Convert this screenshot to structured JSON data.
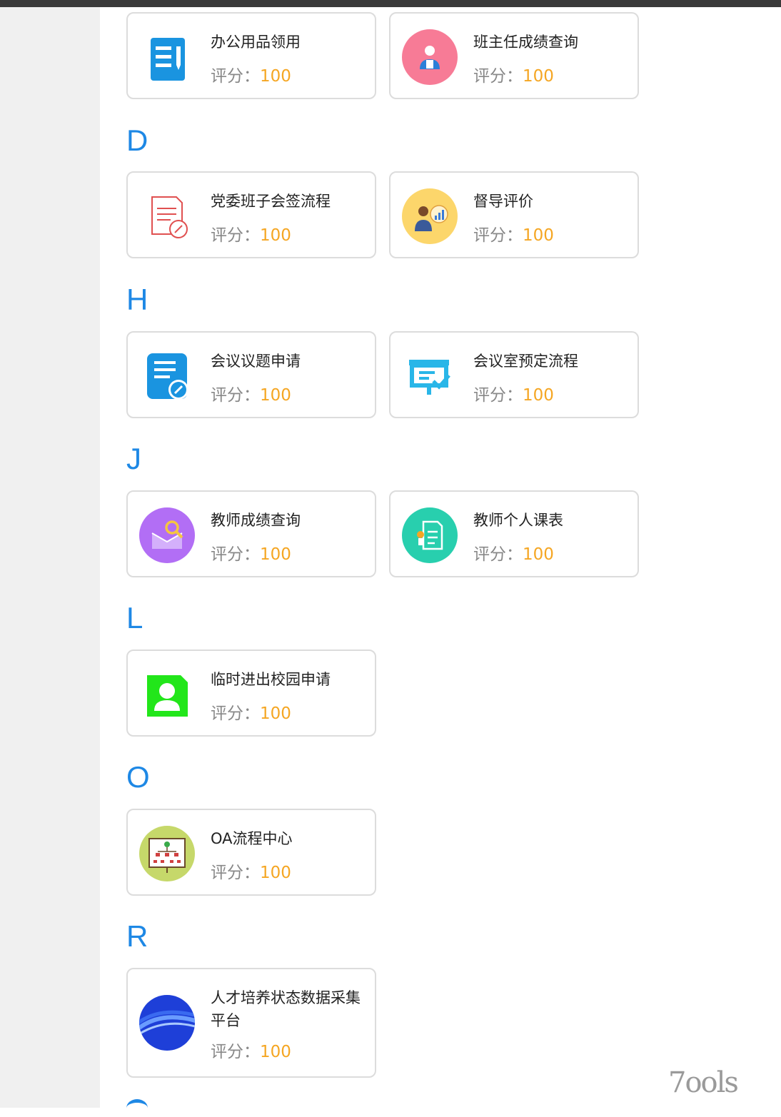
{
  "groups": [
    {
      "letter": "D"
    },
    {
      "letter": "H"
    },
    {
      "letter": "J"
    },
    {
      "letter": "L"
    },
    {
      "letter": "O"
    },
    {
      "letter": "R"
    }
  ],
  "score_label": "评分：",
  "cards": [
    {
      "title": "办公用品领用",
      "score": "100",
      "icon": "document-list-icon"
    },
    {
      "title": "班主任成绩查询",
      "score": "100",
      "icon": "teacher-avatar-icon"
    },
    {
      "title": "党委班子会签流程",
      "score": "100",
      "icon": "document-edit-icon"
    },
    {
      "title": "督导评价",
      "score": "100",
      "icon": "supervisor-chart-icon"
    },
    {
      "title": "会议议题申请",
      "score": "100",
      "icon": "note-pen-icon"
    },
    {
      "title": "会议室预定流程",
      "score": "100",
      "icon": "meeting-board-icon"
    },
    {
      "title": "教师成绩查询",
      "score": "100",
      "icon": "mail-search-icon"
    },
    {
      "title": "教师个人课表",
      "score": "100",
      "icon": "certificate-icon"
    },
    {
      "title": "临时进出校园申请",
      "score": "100",
      "icon": "user-card-icon"
    },
    {
      "title": "OA流程中心",
      "score": "100",
      "icon": "org-chart-icon"
    },
    {
      "title": "人才培养状态数据采集平台",
      "score": "100",
      "icon": "blue-wave-icon"
    }
  ],
  "colors": {
    "accent": "#1e88e5",
    "score": "#f5a623"
  },
  "watermark": "7ools"
}
